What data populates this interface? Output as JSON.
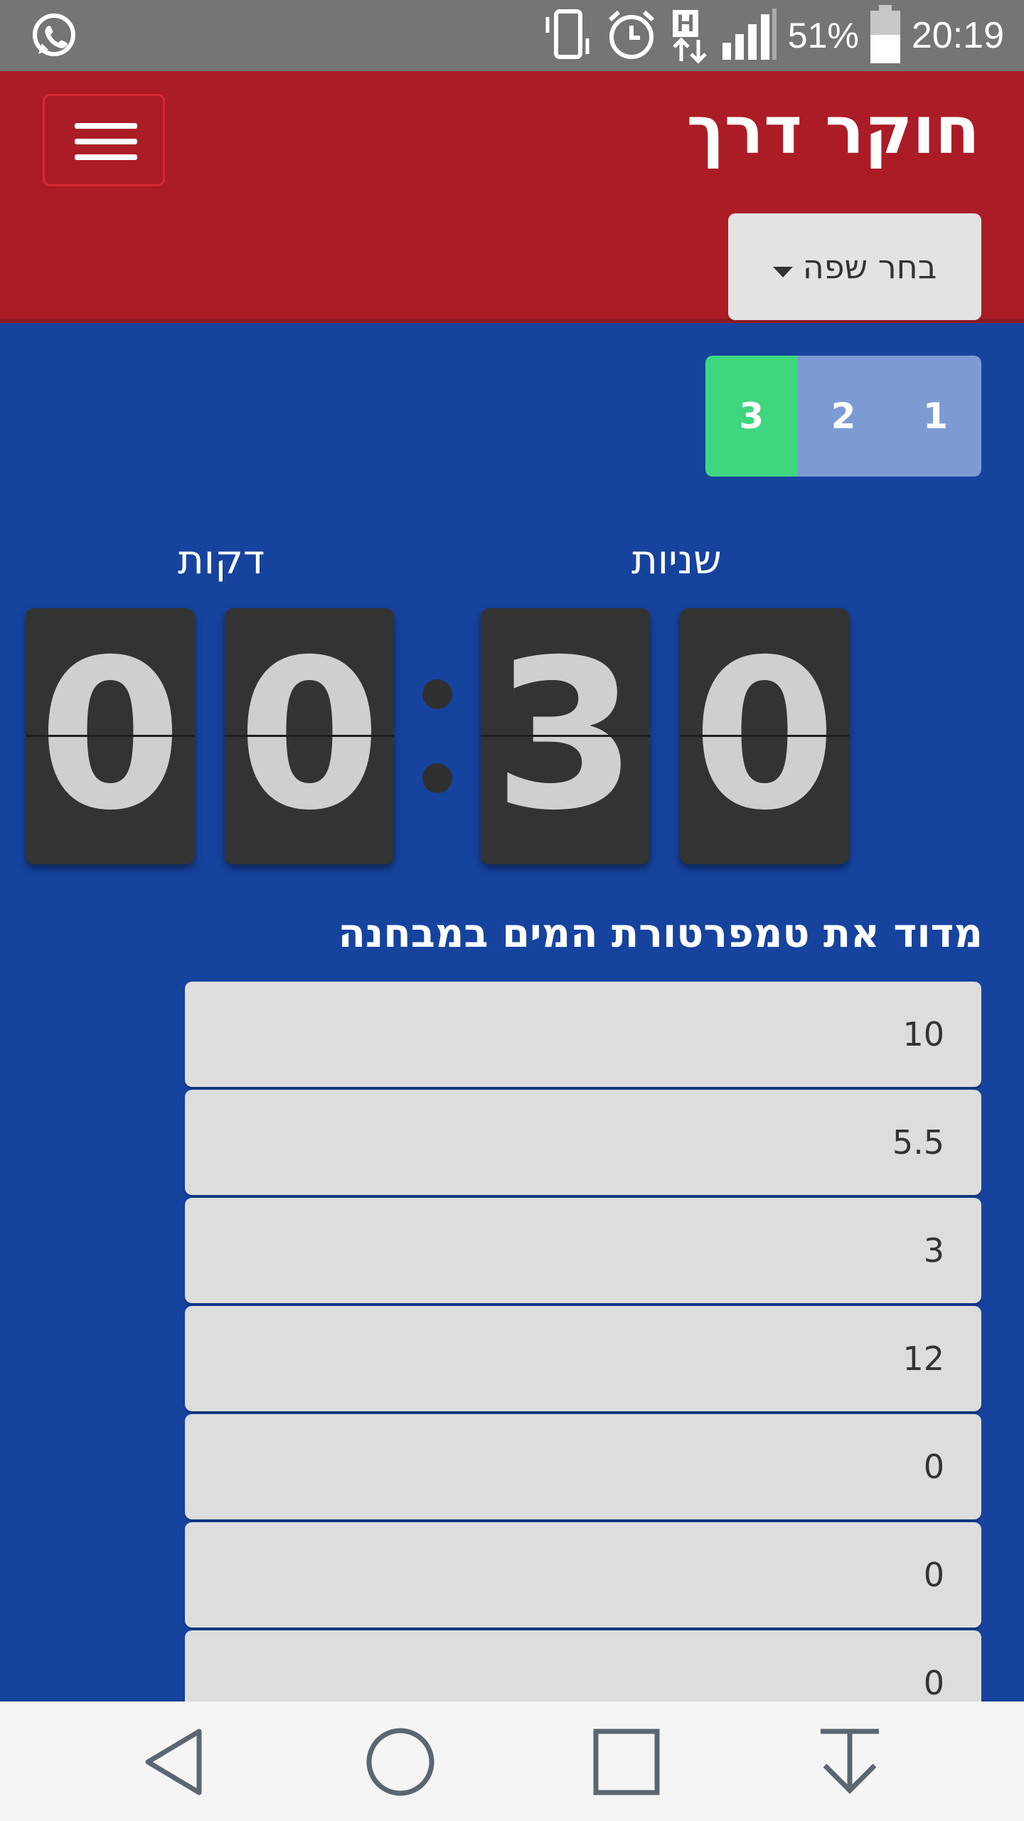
{
  "status_bar": {
    "battery_percent": "51%",
    "time": "20:19",
    "network_badge": "H",
    "icons": [
      "whatsapp-icon",
      "vibrate-icon",
      "alarm-icon",
      "data-h-icon",
      "signal-icon",
      "battery-icon"
    ]
  },
  "header": {
    "title": "חוקר דרך",
    "menu_icon": "hamburger-icon",
    "language_button": "בחר שפה"
  },
  "steps": {
    "items": [
      "1",
      "2",
      "3"
    ],
    "active": "3",
    "active_color": "#3fd680",
    "inactive_color": "#7d9bd3"
  },
  "timer": {
    "minutes_label": "דקות",
    "seconds_label": "שניות",
    "digits": [
      "0",
      "0",
      "3",
      "0"
    ]
  },
  "question": {
    "text": "מדוד את טמפרטורת המים במבחנה",
    "answers": [
      "10",
      "5.5",
      "3",
      "12",
      "0",
      "0",
      "0"
    ]
  },
  "colors": {
    "header_red": "#ab1c26",
    "background_blue": "#16439e"
  },
  "nav_bar": {
    "icons": [
      "back-icon",
      "home-icon",
      "recents-icon",
      "download-icon"
    ]
  }
}
